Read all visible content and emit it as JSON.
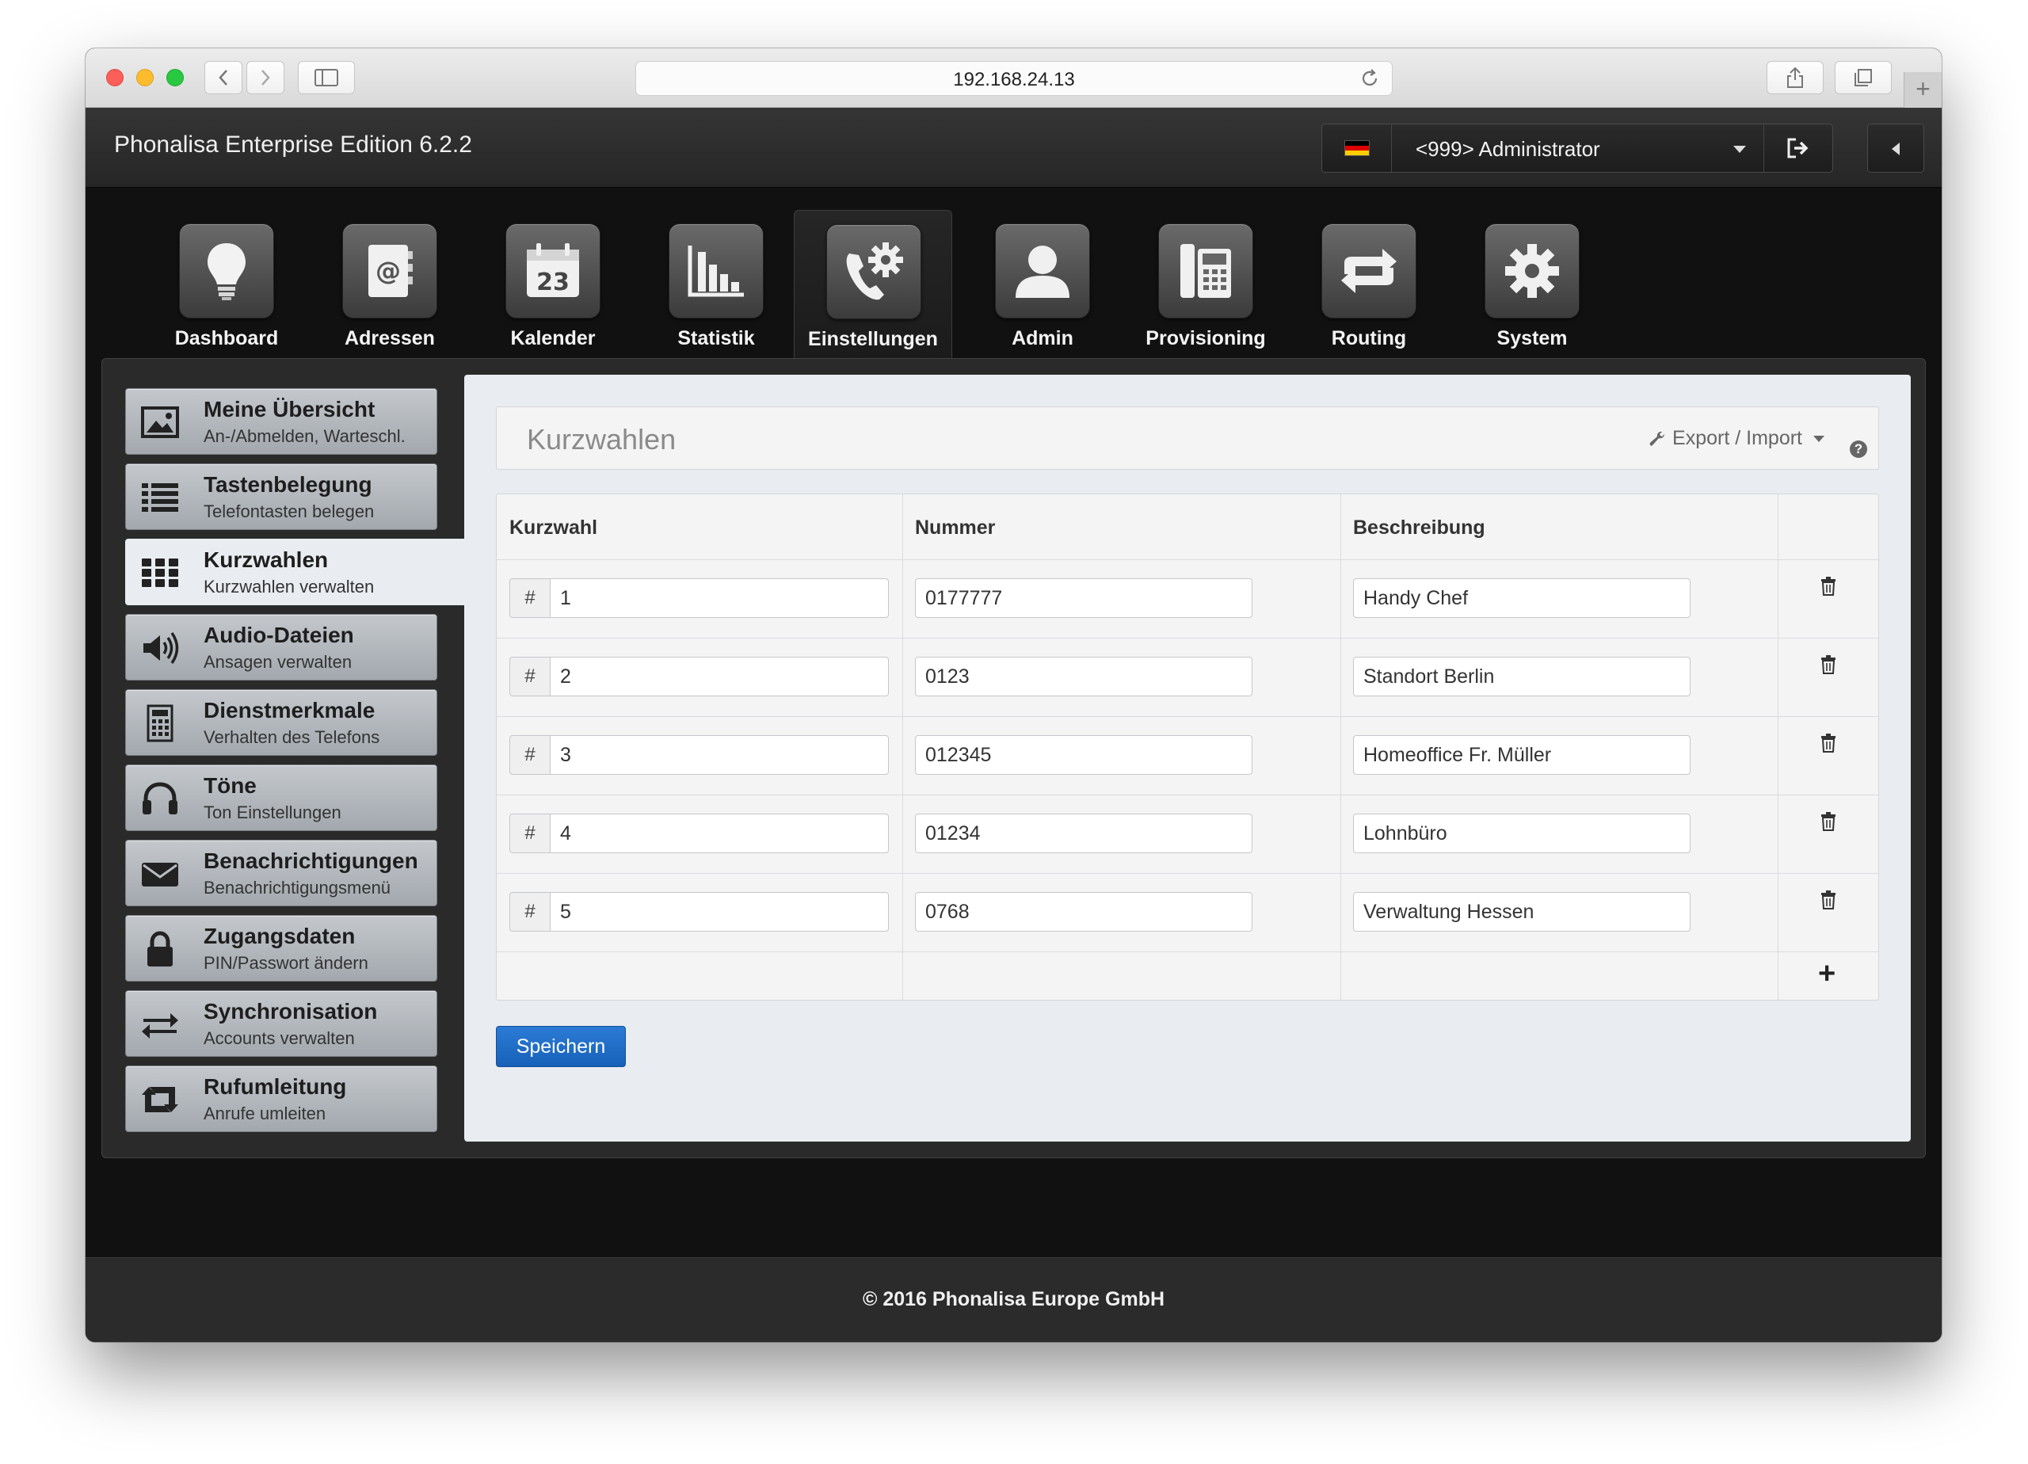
{
  "browser": {
    "url": "192.168.24.13"
  },
  "header": {
    "app_title": "Phonalisa Enterprise Edition 6.2.2",
    "user_label": "<999> Administrator",
    "flag_colors": [
      "#000000",
      "#dd0000",
      "#ffce00"
    ]
  },
  "nav": {
    "tabs": [
      {
        "label": "Dashboard",
        "icon": "lightbulb-icon"
      },
      {
        "label": "Adressen",
        "icon": "address-book-icon"
      },
      {
        "label": "Kalender",
        "icon": "calendar-icon",
        "icon_text": "23"
      },
      {
        "label": "Statistik",
        "icon": "bar-chart-icon"
      },
      {
        "label": "Einstellungen",
        "icon": "phone-settings-icon",
        "active": true
      },
      {
        "label": "Admin",
        "icon": "user-icon"
      },
      {
        "label": "Provisioning",
        "icon": "desk-phone-icon"
      },
      {
        "label": "Routing",
        "icon": "routing-arrows-icon"
      },
      {
        "label": "System",
        "icon": "gear-icon"
      }
    ]
  },
  "sidebar": {
    "items": [
      {
        "title": "Meine Übersicht",
        "subtitle": "An-/Abmelden, Warteschl.",
        "icon": "picture-icon"
      },
      {
        "title": "Tastenbelegung",
        "subtitle": "Telefontasten belegen",
        "icon": "list-icon"
      },
      {
        "title": "Kurzwahlen",
        "subtitle": "Kurzwahlen verwalten",
        "icon": "grid-icon",
        "active": true
      },
      {
        "title": "Audio-Dateien",
        "subtitle": "Ansagen verwalten",
        "icon": "speaker-icon"
      },
      {
        "title": "Dienstmerkmale",
        "subtitle": "Verhalten des Telefons",
        "icon": "keypad-icon"
      },
      {
        "title": "Töne",
        "subtitle": "Ton Einstellungen",
        "icon": "headphones-icon"
      },
      {
        "title": "Benachrichtigungen",
        "subtitle": "Benachrichtigungsmenü",
        "icon": "envelope-icon"
      },
      {
        "title": "Zugangsdaten",
        "subtitle": "PIN/Passwort ändern",
        "icon": "lock-icon"
      },
      {
        "title": "Synchronisation",
        "subtitle": "Accounts verwalten",
        "icon": "sync-arrows-icon"
      },
      {
        "title": "Rufumleitung",
        "subtitle": "Anrufe umleiten",
        "icon": "retweet-icon"
      }
    ]
  },
  "main": {
    "title": "Kurzwahlen",
    "export_label": "Export / Import",
    "help_label": "?",
    "table": {
      "headers": [
        "Kurzwahl",
        "Nummer",
        "Beschreibung"
      ],
      "prefix": "#",
      "rows": [
        {
          "kurzwahl": "1",
          "nummer": "0177777",
          "beschreibung": "Handy Chef"
        },
        {
          "kurzwahl": "2",
          "nummer": "0123",
          "beschreibung": "Standort Berlin"
        },
        {
          "kurzwahl": "3",
          "nummer": "012345",
          "beschreibung": "Homeoffice Fr. Müller"
        },
        {
          "kurzwahl": "4",
          "nummer": "01234",
          "beschreibung": "Lohnbüro"
        },
        {
          "kurzwahl": "5",
          "nummer": "0768",
          "beschreibung": "Verwaltung Hessen"
        }
      ],
      "add_label": "+"
    },
    "save_label": "Speichern"
  },
  "footer": {
    "text": "© 2016 Phonalisa Europe GmbH"
  }
}
